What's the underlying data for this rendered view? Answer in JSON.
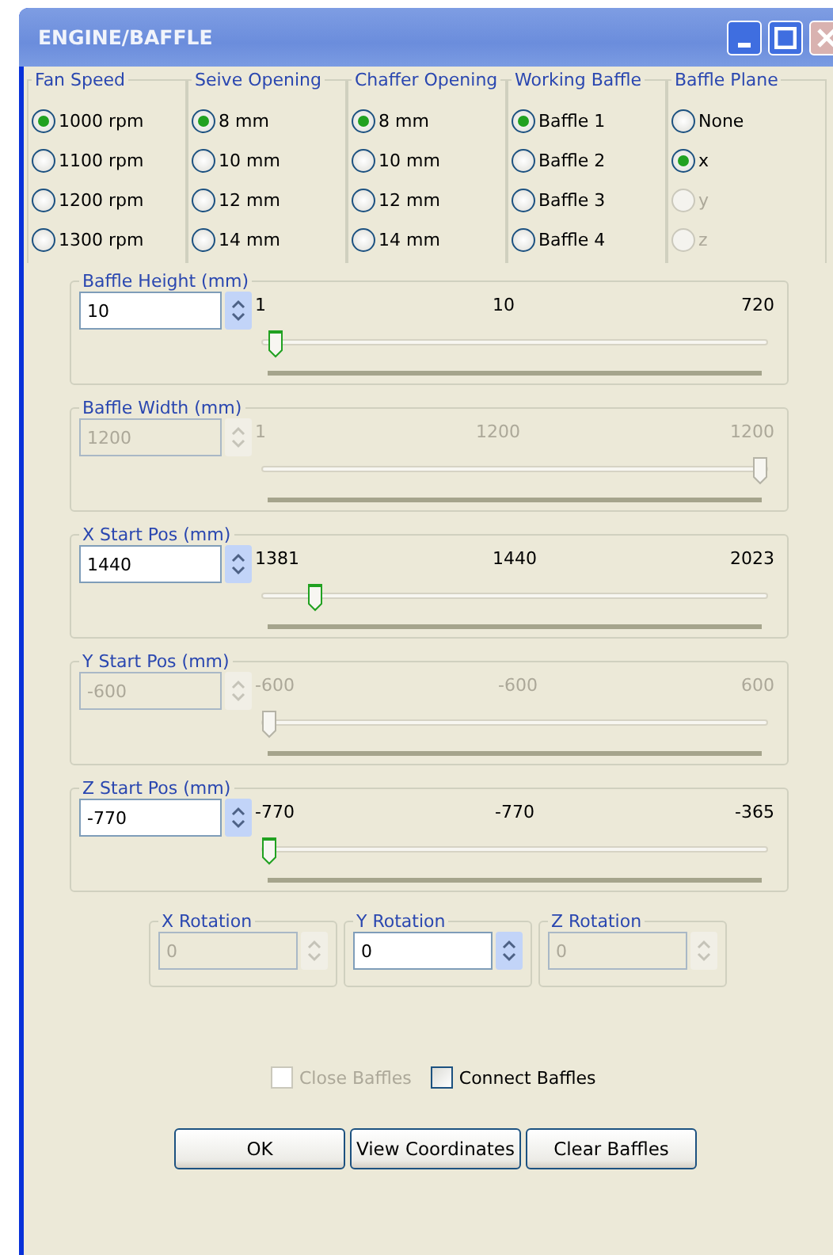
{
  "window": {
    "title": "ENGINE/BAFFLE"
  },
  "radio_groups": [
    {
      "label": "Fan Speed",
      "options": [
        {
          "label": "1000 rpm",
          "selected": true,
          "disabled": false
        },
        {
          "label": "1100 rpm",
          "selected": false,
          "disabled": false
        },
        {
          "label": "1200 rpm",
          "selected": false,
          "disabled": false
        },
        {
          "label": "1300 rpm",
          "selected": false,
          "disabled": false
        }
      ]
    },
    {
      "label": "Seive Opening",
      "options": [
        {
          "label": "8 mm",
          "selected": true,
          "disabled": false
        },
        {
          "label": "10 mm",
          "selected": false,
          "disabled": false
        },
        {
          "label": "12 mm",
          "selected": false,
          "disabled": false
        },
        {
          "label": "14 mm",
          "selected": false,
          "disabled": false
        }
      ]
    },
    {
      "label": "Chaffer Opening",
      "options": [
        {
          "label": "8 mm",
          "selected": true,
          "disabled": false
        },
        {
          "label": "10 mm",
          "selected": false,
          "disabled": false
        },
        {
          "label": "12 mm",
          "selected": false,
          "disabled": false
        },
        {
          "label": "14 mm",
          "selected": false,
          "disabled": false
        }
      ]
    },
    {
      "label": "Working Baffle",
      "options": [
        {
          "label": "Baffle 1",
          "selected": true,
          "disabled": false
        },
        {
          "label": "Baffle 2",
          "selected": false,
          "disabled": false
        },
        {
          "label": "Baffle 3",
          "selected": false,
          "disabled": false
        },
        {
          "label": "Baffle 4",
          "selected": false,
          "disabled": false
        }
      ]
    },
    {
      "label": "Baffle Plane",
      "options": [
        {
          "label": "None",
          "selected": false,
          "disabled": false
        },
        {
          "label": "x",
          "selected": true,
          "disabled": false
        },
        {
          "label": "y",
          "selected": false,
          "disabled": true
        },
        {
          "label": "z",
          "selected": false,
          "disabled": true
        }
      ]
    }
  ],
  "sliders": [
    {
      "label": "Baffle Height (mm)",
      "value": "10",
      "disabled": false,
      "min": "1",
      "mid": "10",
      "max": "720",
      "level": 0.013
    },
    {
      "label": "Baffle Width (mm)",
      "value": "1200",
      "disabled": true,
      "min": "1",
      "mid": "1200",
      "max": "1200",
      "level": 1
    },
    {
      "label": "X Start Pos (mm)",
      "value": "1440",
      "disabled": false,
      "min": "1381",
      "mid": "1440",
      "max": "2023",
      "level": 0.092
    },
    {
      "label": "Y Start Pos (mm)",
      "value": "-600",
      "disabled": true,
      "min": "-600",
      "mid": "-600",
      "max": "600",
      "level": 0
    },
    {
      "label": "Z Start Pos (mm)",
      "value": "-770",
      "disabled": false,
      "min": "-770",
      "mid": "-770",
      "max": "-365",
      "level": 0
    }
  ],
  "rotations": [
    {
      "label": "X Rotation",
      "value": "0",
      "disabled": true
    },
    {
      "label": "Y Rotation",
      "value": "0",
      "disabled": false
    },
    {
      "label": "Z Rotation",
      "value": "0",
      "disabled": true
    }
  ],
  "checkboxes": [
    {
      "label": "Close Baffles",
      "checked": false,
      "disabled": true
    },
    {
      "label": "Connect Baffles",
      "checked": false,
      "disabled": false
    }
  ],
  "buttons": [
    "OK",
    "View Coordinates",
    "Clear Baffles"
  ]
}
